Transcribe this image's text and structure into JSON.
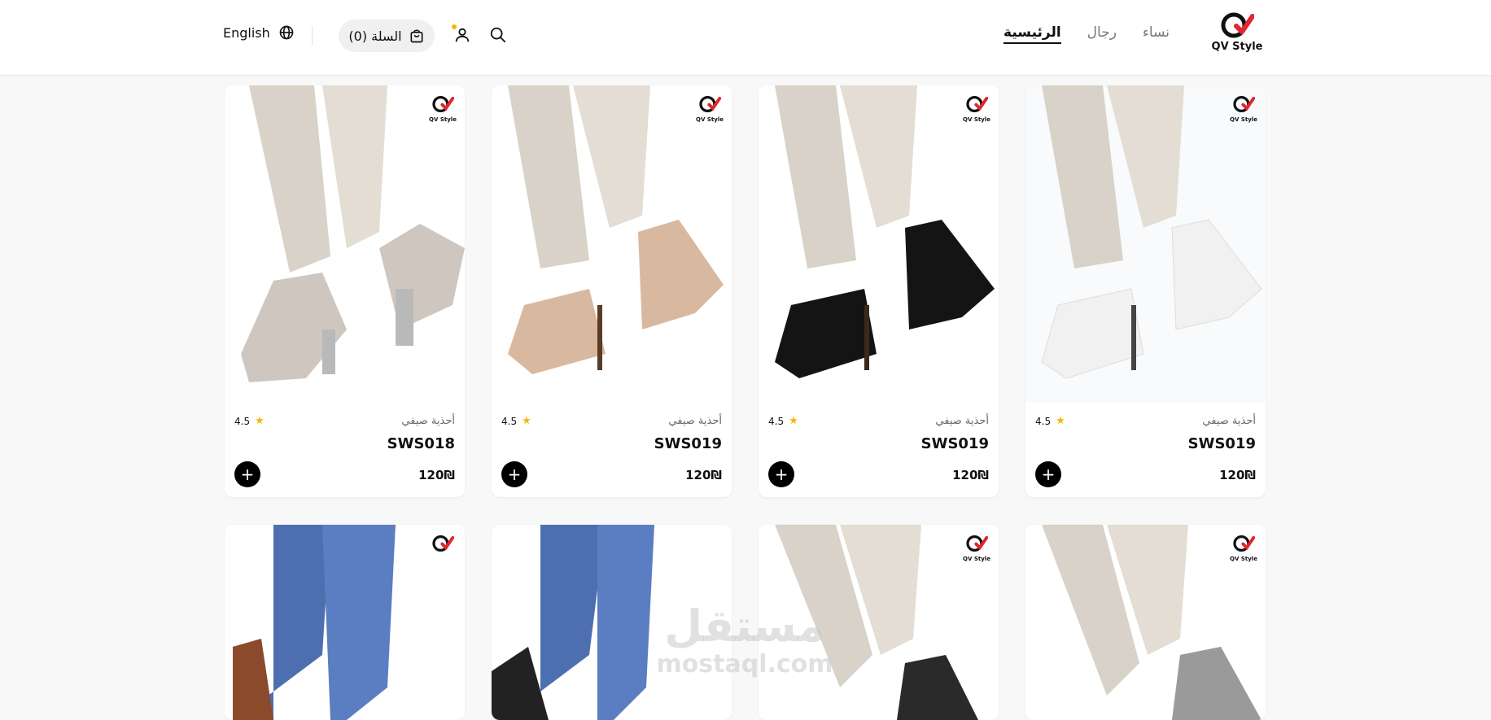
{
  "brand": {
    "logo_text": "QV Style"
  },
  "nav": [
    {
      "label": "الرئيسية",
      "active": true
    },
    {
      "label": "رجال",
      "active": false
    },
    {
      "label": "نساء",
      "active": false
    }
  ],
  "header": {
    "cart_label": "السلة (0)",
    "language_label": "English",
    "search_icon": "search-icon",
    "user_icon": "user-icon",
    "cart_icon": "shopping-bag-icon",
    "globe_icon": "globe-icon"
  },
  "products": [
    {
      "category": "أحذية صيفي",
      "name": "SWS018",
      "price": "120₪",
      "rating": "4.5",
      "shoe_color": "#cfc7bf",
      "pants_color": "#d8d2c8"
    },
    {
      "category": "أحذية صيفي",
      "name": "SWS019",
      "price": "120₪",
      "rating": "4.5",
      "shoe_color": "#d8b9a0",
      "pants_color": "#d8d2c8"
    },
    {
      "category": "أحذية صيفي",
      "name": "SWS019",
      "price": "120₪",
      "rating": "4.5",
      "shoe_color": "#141414",
      "pants_color": "#d8d2c8"
    },
    {
      "category": "أحذية صيفي",
      "name": "SWS019",
      "price": "120₪",
      "rating": "4.5",
      "shoe_color": "#f4f4f4",
      "pants_color": "#d8d2c8"
    }
  ],
  "second_row": [
    {
      "shoe_color": "#8b4a2b",
      "pants_color": "#4d6fb0"
    },
    {
      "shoe_color": "#222222",
      "pants_color": "#4d6fb0"
    },
    {
      "shoe_color": "#2a2a2a",
      "pants_color": "#d8d2c8"
    },
    {
      "shoe_color": "#9a9a9a",
      "pants_color": "#d8d2c8"
    }
  ],
  "watermark": {
    "arabic": "مستقل",
    "latin": "mostaql.com"
  },
  "colors": {
    "accent": "#f5b50a",
    "logo_red": "#e0262f"
  }
}
